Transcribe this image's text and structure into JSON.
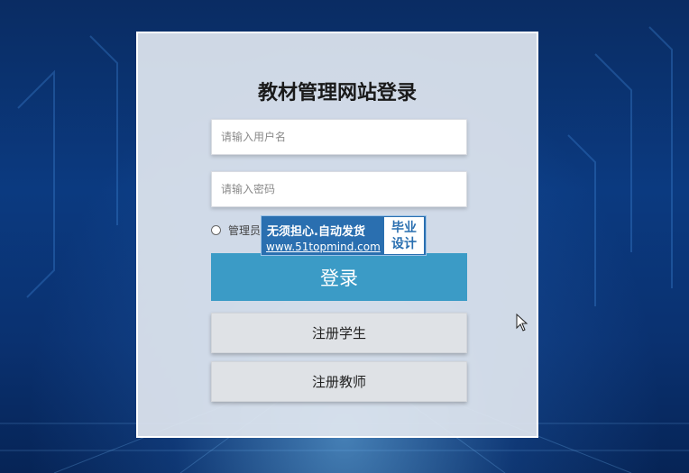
{
  "page": {
    "title": "教材管理网站登录"
  },
  "form": {
    "username_placeholder": "请输入用户名",
    "password_placeholder": "请输入密码",
    "role_label": "管理员",
    "login_label": "登录",
    "register_student_label": "注册学生",
    "register_teacher_label": "注册教师"
  },
  "watermark": {
    "line1": "无须担心.自动发货",
    "line2": "www.51topmind.com",
    "box_line1": "毕业",
    "box_line2": "设计"
  },
  "colors": {
    "login_button": "#3b9bc6",
    "background": "#0b3a80",
    "watermark": "#2a6fb0"
  }
}
